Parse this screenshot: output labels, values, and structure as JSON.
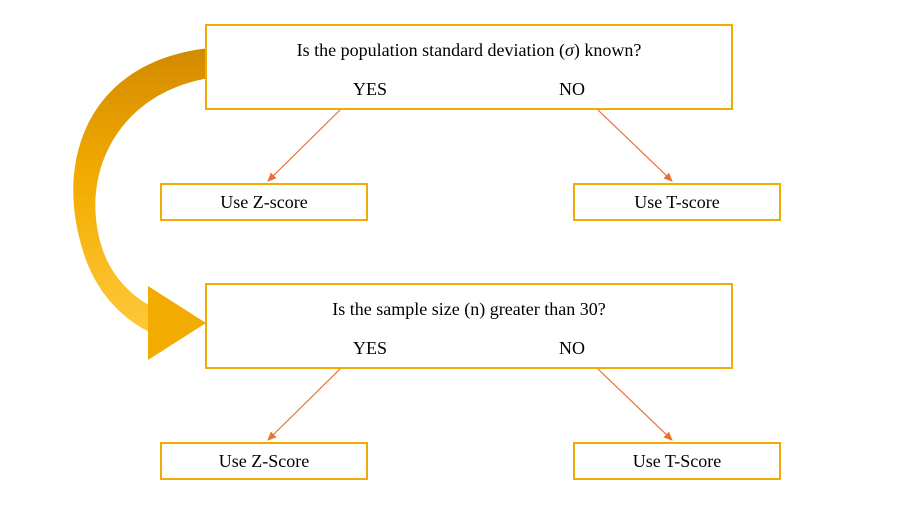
{
  "q1": {
    "title_prefix": "Is the population standard deviation (",
    "sigma": "σ",
    "title_suffix": ") known?",
    "yes": "YES",
    "no": "NO"
  },
  "a1_yes": "Use Z-score",
  "a1_no": "Use T-score",
  "q2": {
    "title": "Is the sample size (n) greater than 30?",
    "yes": "YES",
    "no": "NO"
  },
  "a2_yes": "Use Z-Score",
  "a2_no": "Use T-Score",
  "colors": {
    "border": "#f2ab00",
    "arrow_line": "#e97132",
    "swoosh_fill": "#f2ab00",
    "swoosh_dark": "#d28a00"
  }
}
